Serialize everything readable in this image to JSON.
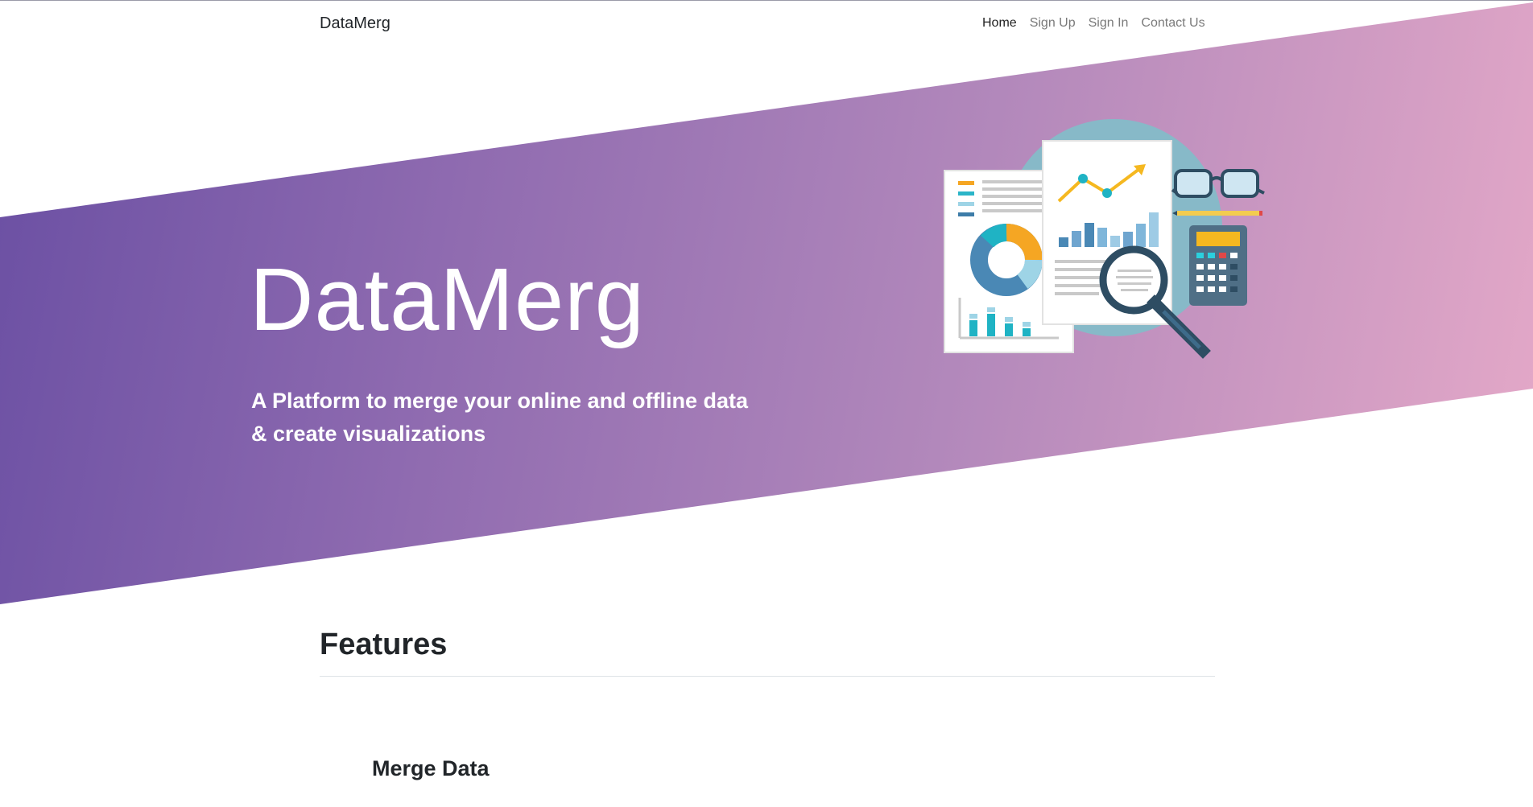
{
  "navbar": {
    "brand": "DataMerg",
    "links": [
      {
        "label": "Home",
        "active": true
      },
      {
        "label": "Sign Up",
        "active": false
      },
      {
        "label": "Sign In",
        "active": false
      },
      {
        "label": "Contact Us",
        "active": false
      }
    ]
  },
  "hero": {
    "title": "DataMerg",
    "subtitle_line1": "A Platform to merge your online and offline data",
    "subtitle_line2": "& create visualizations",
    "gradient_colors": [
      "#6a4fa3",
      "#8f6bb0",
      "#b288bb",
      "#e5a9c8"
    ],
    "illustration_icons": [
      "report-document-icon",
      "line-chart-icon",
      "magnifier-icon",
      "glasses-icon",
      "pencil-icon",
      "calculator-icon",
      "donut-chart-icon",
      "bar-chart-icon"
    ]
  },
  "features": {
    "heading": "Features",
    "items": [
      {
        "title": "Merge Data"
      }
    ]
  }
}
